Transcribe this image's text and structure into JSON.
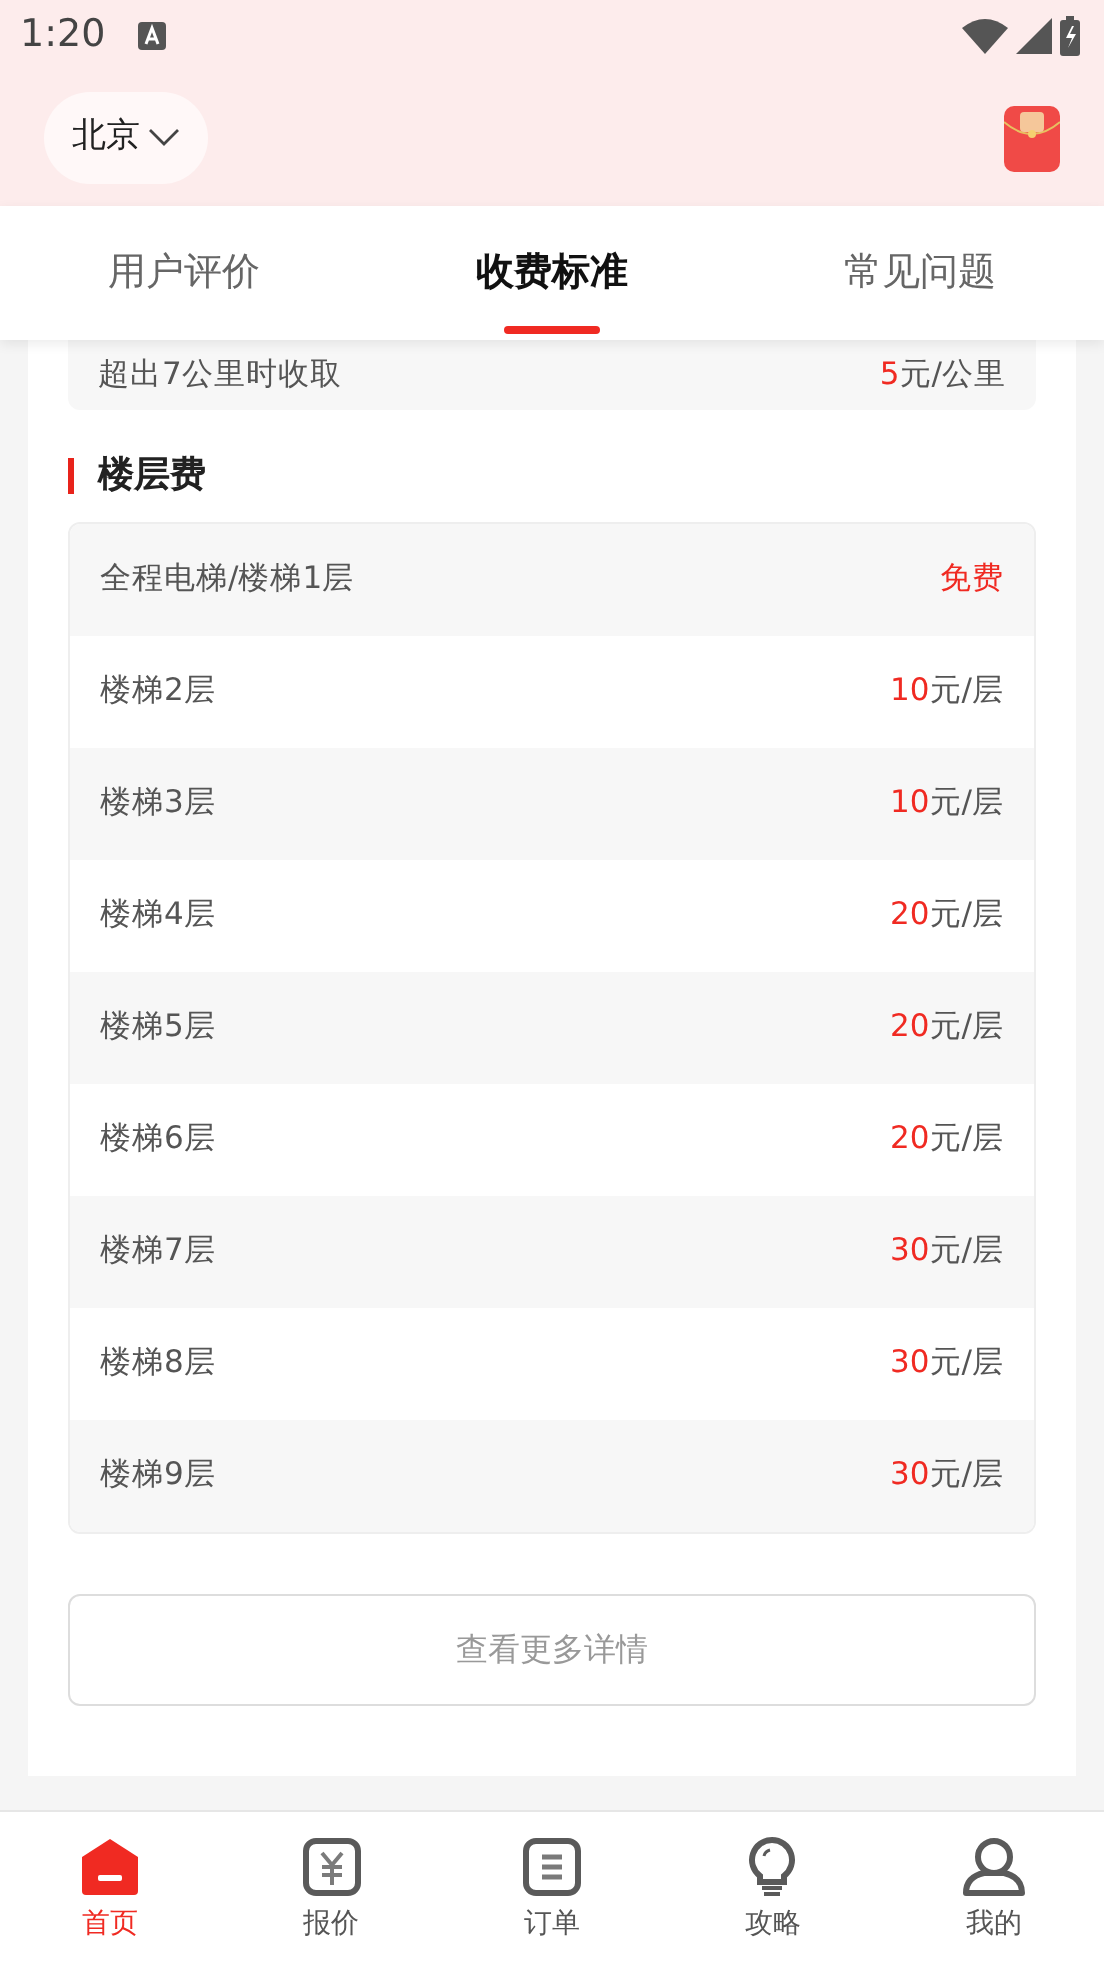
{
  "status_bar": {
    "time": "1:20"
  },
  "header": {
    "city": "北京"
  },
  "tabs": [
    {
      "label": "用户评价",
      "selected": false
    },
    {
      "label": "收费标准",
      "selected": true
    },
    {
      "label": "常见问题",
      "selected": false
    }
  ],
  "distance_row": {
    "label": "超出7公里时收取",
    "amount": "5",
    "unit": "元/公里"
  },
  "floor_section": {
    "title": "楼层费",
    "rows": [
      {
        "label": "全程电梯/楼梯1层",
        "amount": "免费"
      },
      {
        "label": "楼梯2层",
        "amount": "10",
        "unit": "元/层"
      },
      {
        "label": "楼梯3层",
        "amount": "10",
        "unit": "元/层"
      },
      {
        "label": "楼梯4层",
        "amount": "20",
        "unit": "元/层"
      },
      {
        "label": "楼梯5层",
        "amount": "20",
        "unit": "元/层"
      },
      {
        "label": "楼梯6层",
        "amount": "20",
        "unit": "元/层"
      },
      {
        "label": "楼梯7层",
        "amount": "30",
        "unit": "元/层"
      },
      {
        "label": "楼梯8层",
        "amount": "30",
        "unit": "元/层"
      },
      {
        "label": "楼梯9层",
        "amount": "30",
        "unit": "元/层"
      }
    ]
  },
  "more_button": "查看更多详情",
  "bottom_nav": [
    {
      "label": "首页",
      "kind": "home",
      "selected": true
    },
    {
      "label": "报价",
      "kind": "quote",
      "selected": false
    },
    {
      "label": "订单",
      "kind": "order",
      "selected": false
    },
    {
      "label": "攻略",
      "kind": "guide",
      "selected": false
    },
    {
      "label": "我的",
      "kind": "profile",
      "selected": false
    }
  ]
}
